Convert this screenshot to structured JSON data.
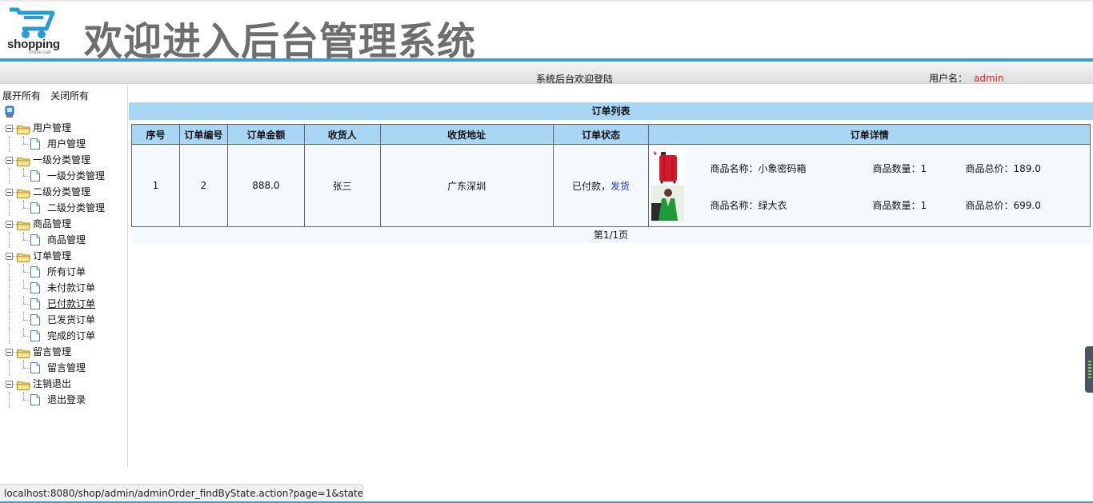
{
  "header": {
    "logo_text": "shopping",
    "logo_sub": "online cart",
    "title": "欢迎进入后台管理系统",
    "welcome": "系统后台欢迎登陆",
    "user_label": "用户名：",
    "user_name": "admin"
  },
  "colors": {
    "accent": "#3a9de3",
    "table_header": "#a9d6f5",
    "user_name": "#e02020",
    "link": "#1a33d6"
  },
  "sidebar": {
    "expand_all": "展开所有",
    "collapse_all": "关闭所有",
    "groups": [
      {
        "label": "用户管理",
        "items": [
          "用户管理"
        ]
      },
      {
        "label": "一级分类管理",
        "items": [
          "一级分类管理"
        ]
      },
      {
        "label": "二级分类管理",
        "items": [
          "二级分类管理"
        ]
      },
      {
        "label": "商品管理",
        "items": [
          "商品管理"
        ]
      },
      {
        "label": "订单管理",
        "items": [
          "所有订单",
          "未付款订单",
          "已付款订单",
          "已发货订单",
          "完成的订单"
        ]
      },
      {
        "label": "留言管理",
        "items": [
          "留言管理"
        ]
      },
      {
        "label": "注销退出",
        "items": [
          "退出登录"
        ]
      }
    ]
  },
  "orders": {
    "title": "订单列表",
    "columns": [
      "序号",
      "订单编号",
      "订单金额",
      "收货人",
      "收货地址",
      "订单状态",
      "订单详情"
    ],
    "row": {
      "index": "1",
      "order_no": "2",
      "amount": "888.0",
      "receiver": "张三",
      "address": "广东深圳",
      "status": "已付款，",
      "action": "发货",
      "details": [
        {
          "name": "商品名称：小象密码箱",
          "qty": "商品数量：1",
          "total": "商品总价：189.0",
          "icon": "red-suitcase-image"
        },
        {
          "name": "商品名称：绿大衣",
          "qty": "商品数量：1",
          "total": "商品总价：699.0",
          "icon": "green-coat-image"
        }
      ]
    },
    "pager": "第1/1页"
  },
  "status_bar": {
    "url": "localhost:8080/shop/admin/adminOrder_findByState.action?page=1&state..."
  }
}
